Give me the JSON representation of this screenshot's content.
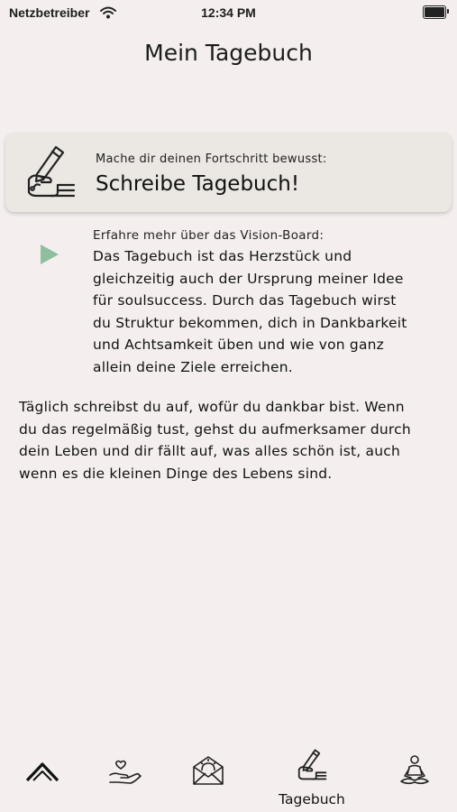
{
  "status_bar": {
    "carrier": "Netzbetreiber",
    "time": "12:34 PM",
    "wifi_icon": "wifi-icon",
    "battery_icon": "battery-icon"
  },
  "header": {
    "title": "Mein Tagebuch"
  },
  "card": {
    "icon": "writing-hand-icon",
    "subtitle": "Mache dir deinen Fortschritt bewusst:",
    "title": "Schreibe Tagebuch!"
  },
  "info": {
    "play_icon": "play-icon",
    "play_color": "#8fbf9f",
    "subtitle": "Erfahre mehr über das Vision-Board:",
    "lines": [
      "Das Tagebuch ist das Herzstück und",
      "gleichzeitig auch der Ursprung meiner Idee",
      "für soulsuccess. Durch das Tagebuch wirst",
      "du Struktur bekommen, dich in Dankbarkeit",
      "und Achtsamkeit üben und wie von ganz",
      "allein deine Ziele erreichen."
    ]
  },
  "paragraph": {
    "lines": [
      "Täglich schreibst du auf, wofür du dankbar bist.  Wenn",
      "du das regelmäßig tust, gehst du aufmerksamer durch",
      "dein Leben und dir fällt auf, was alles schön ist, auch",
      "wenn es die kleinen Dinge des Lebens sind."
    ]
  },
  "tabbar": {
    "tabs": [
      {
        "icon": "chevron-up-icon",
        "label": ""
      },
      {
        "icon": "heart-hand-icon",
        "label": ""
      },
      {
        "icon": "envelope-sun-icon",
        "label": ""
      },
      {
        "icon": "writing-hand-icon",
        "label": "Tagebuch",
        "selected": true
      },
      {
        "icon": "meditation-icon",
        "label": ""
      }
    ]
  }
}
